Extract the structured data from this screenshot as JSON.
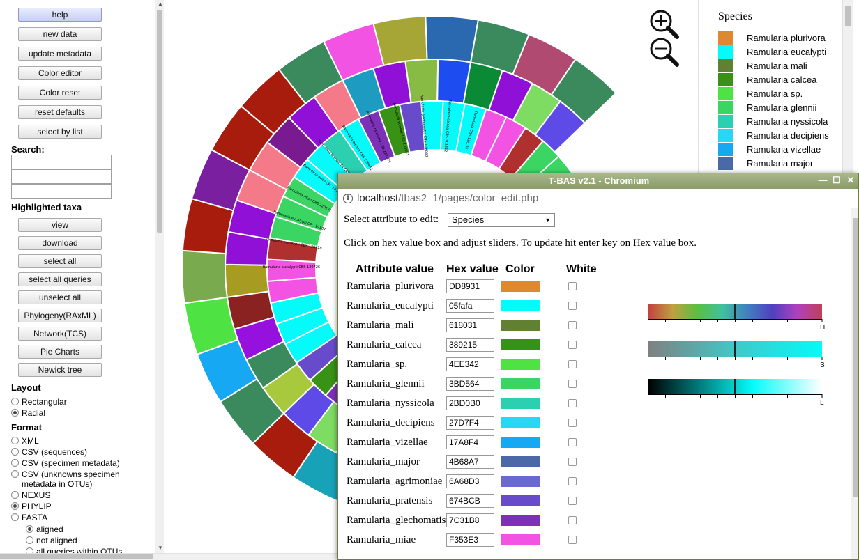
{
  "sidebar": {
    "buttons_top": [
      "help",
      "new data",
      "update metadata",
      "Color editor",
      "Color reset",
      "reset defaults",
      "select by list"
    ],
    "search_label": "Search:",
    "highlighted_label": "Highlighted taxa",
    "buttons_bottom": [
      "view",
      "download",
      "select all",
      "select all queries",
      "unselect all",
      "Phylogeny(RAxML)",
      "Network(TCS)",
      "Pie Charts",
      "Newick tree"
    ],
    "layout_label": "Layout",
    "layout_options": [
      {
        "label": "Rectangular",
        "checked": false
      },
      {
        "label": "Radial",
        "checked": true
      }
    ],
    "format_label": "Format",
    "format_options": [
      {
        "label": "XML",
        "checked": false
      },
      {
        "label": "CSV (sequences)",
        "checked": false
      },
      {
        "label": "CSV (specimen metadata)",
        "checked": false
      },
      {
        "label": "CSV (unknowns specimen",
        "label2": "metadata in OTUs)",
        "checked": false
      },
      {
        "label": "NEXUS",
        "checked": false
      },
      {
        "label": "PHYLIP",
        "checked": true
      },
      {
        "label": "FASTA",
        "checked": false
      }
    ],
    "fasta_options": [
      {
        "label": "aligned",
        "checked": true
      },
      {
        "label": "not aligned",
        "checked": false
      },
      {
        "label": "all queries within OTUs",
        "checked": false
      }
    ]
  },
  "tree": {
    "zoom_in_icon": "zoom-in-icon",
    "zoom_out_icon": "zoom-out-icon",
    "tip_labels": [
      "Ramularia eucalypti CBS 120726",
      "Ramularia eucalypti CBS 120728",
      "Ramularia eucalypti CPC 19187",
      "Ramularia miae CBS 120121",
      "Ramularia miae CPC 19770",
      "Ramularia hordeicola CBS 137277",
      "Ramularia glennii CBS 129441",
      "Ramularia ramicola CBS 127695",
      "Ramularia vizellae CBS 135601",
      "Ramularia glechomatis CBS 108083",
      "Ramularia calcea CBS 101612",
      "Ramularia CBS 126.35"
    ]
  },
  "legend": {
    "title": "Species",
    "items": [
      {
        "label": "Ramularia plurivora",
        "color": "#DD8931"
      },
      {
        "label": "Ramularia eucalypti",
        "color": "#05fafa"
      },
      {
        "label": "Ramularia mali",
        "color": "#618031"
      },
      {
        "label": "Ramularia calcea",
        "color": "#389215"
      },
      {
        "label": "Ramularia sp.",
        "color": "#4EE342"
      },
      {
        "label": "Ramularia glennii",
        "color": "#3BD564"
      },
      {
        "label": "Ramularia nyssicola",
        "color": "#2BD0B0"
      },
      {
        "label": "Ramularia decipiens",
        "color": "#27D7F4"
      },
      {
        "label": "Ramularia vizellae",
        "color": "#17A8F4"
      },
      {
        "label": "Ramularia major",
        "color": "#4B68A7"
      }
    ]
  },
  "popup": {
    "title": "T-BAS v2.1 - Chromium",
    "url_host": "localhost",
    "url_path": "/tbas2_1/pages/color_edit.php",
    "attr_label": "Select attribute to edit:",
    "attr_value": "Species",
    "instructions": "Click on hex value box and adjust sliders. To update hit enter key on Hex value box.",
    "headers": {
      "attr": "Attribute value",
      "hex": "Hex value",
      "color": "Color",
      "white": "White"
    },
    "rows": [
      {
        "name": "Ramularia_plurivora",
        "hex": "DD8931",
        "color": "#DD8931"
      },
      {
        "name": "Ramularia_eucalypti",
        "hex": "05fafa",
        "color": "#05fafa"
      },
      {
        "name": "Ramularia_mali",
        "hex": "618031",
        "color": "#618031"
      },
      {
        "name": "Ramularia_calcea",
        "hex": "389215",
        "color": "#389215"
      },
      {
        "name": "Ramularia_sp.",
        "hex": "4EE342",
        "color": "#4EE342"
      },
      {
        "name": "Ramularia_glennii",
        "hex": "3BD564",
        "color": "#3BD564"
      },
      {
        "name": "Ramularia_nyssicola",
        "hex": "2BD0B0",
        "color": "#2BD0B0"
      },
      {
        "name": "Ramularia_decipiens",
        "hex": "27D7F4",
        "color": "#27D7F4"
      },
      {
        "name": "Ramularia_vizellae",
        "hex": "17A8F4",
        "color": "#17A8F4"
      },
      {
        "name": "Ramularia_major",
        "hex": "4B68A7",
        "color": "#4B68A7"
      },
      {
        "name": "Ramularia_agrimoniae",
        "hex": "6A68D3",
        "color": "#6A68D3"
      },
      {
        "name": "Ramularia_pratensis",
        "hex": "674BCB",
        "color": "#674BCB"
      },
      {
        "name": "Ramularia_glechomatis",
        "hex": "7C31B8",
        "color": "#7C31B8"
      },
      {
        "name": "Ramularia_miae",
        "hex": "F353E3",
        "color": "#F353E3"
      }
    ],
    "sliders": [
      {
        "letter": "H",
        "level": 0.5
      },
      {
        "letter": "S",
        "level": 0.5
      },
      {
        "letter": "L",
        "level": 0.5
      }
    ]
  }
}
